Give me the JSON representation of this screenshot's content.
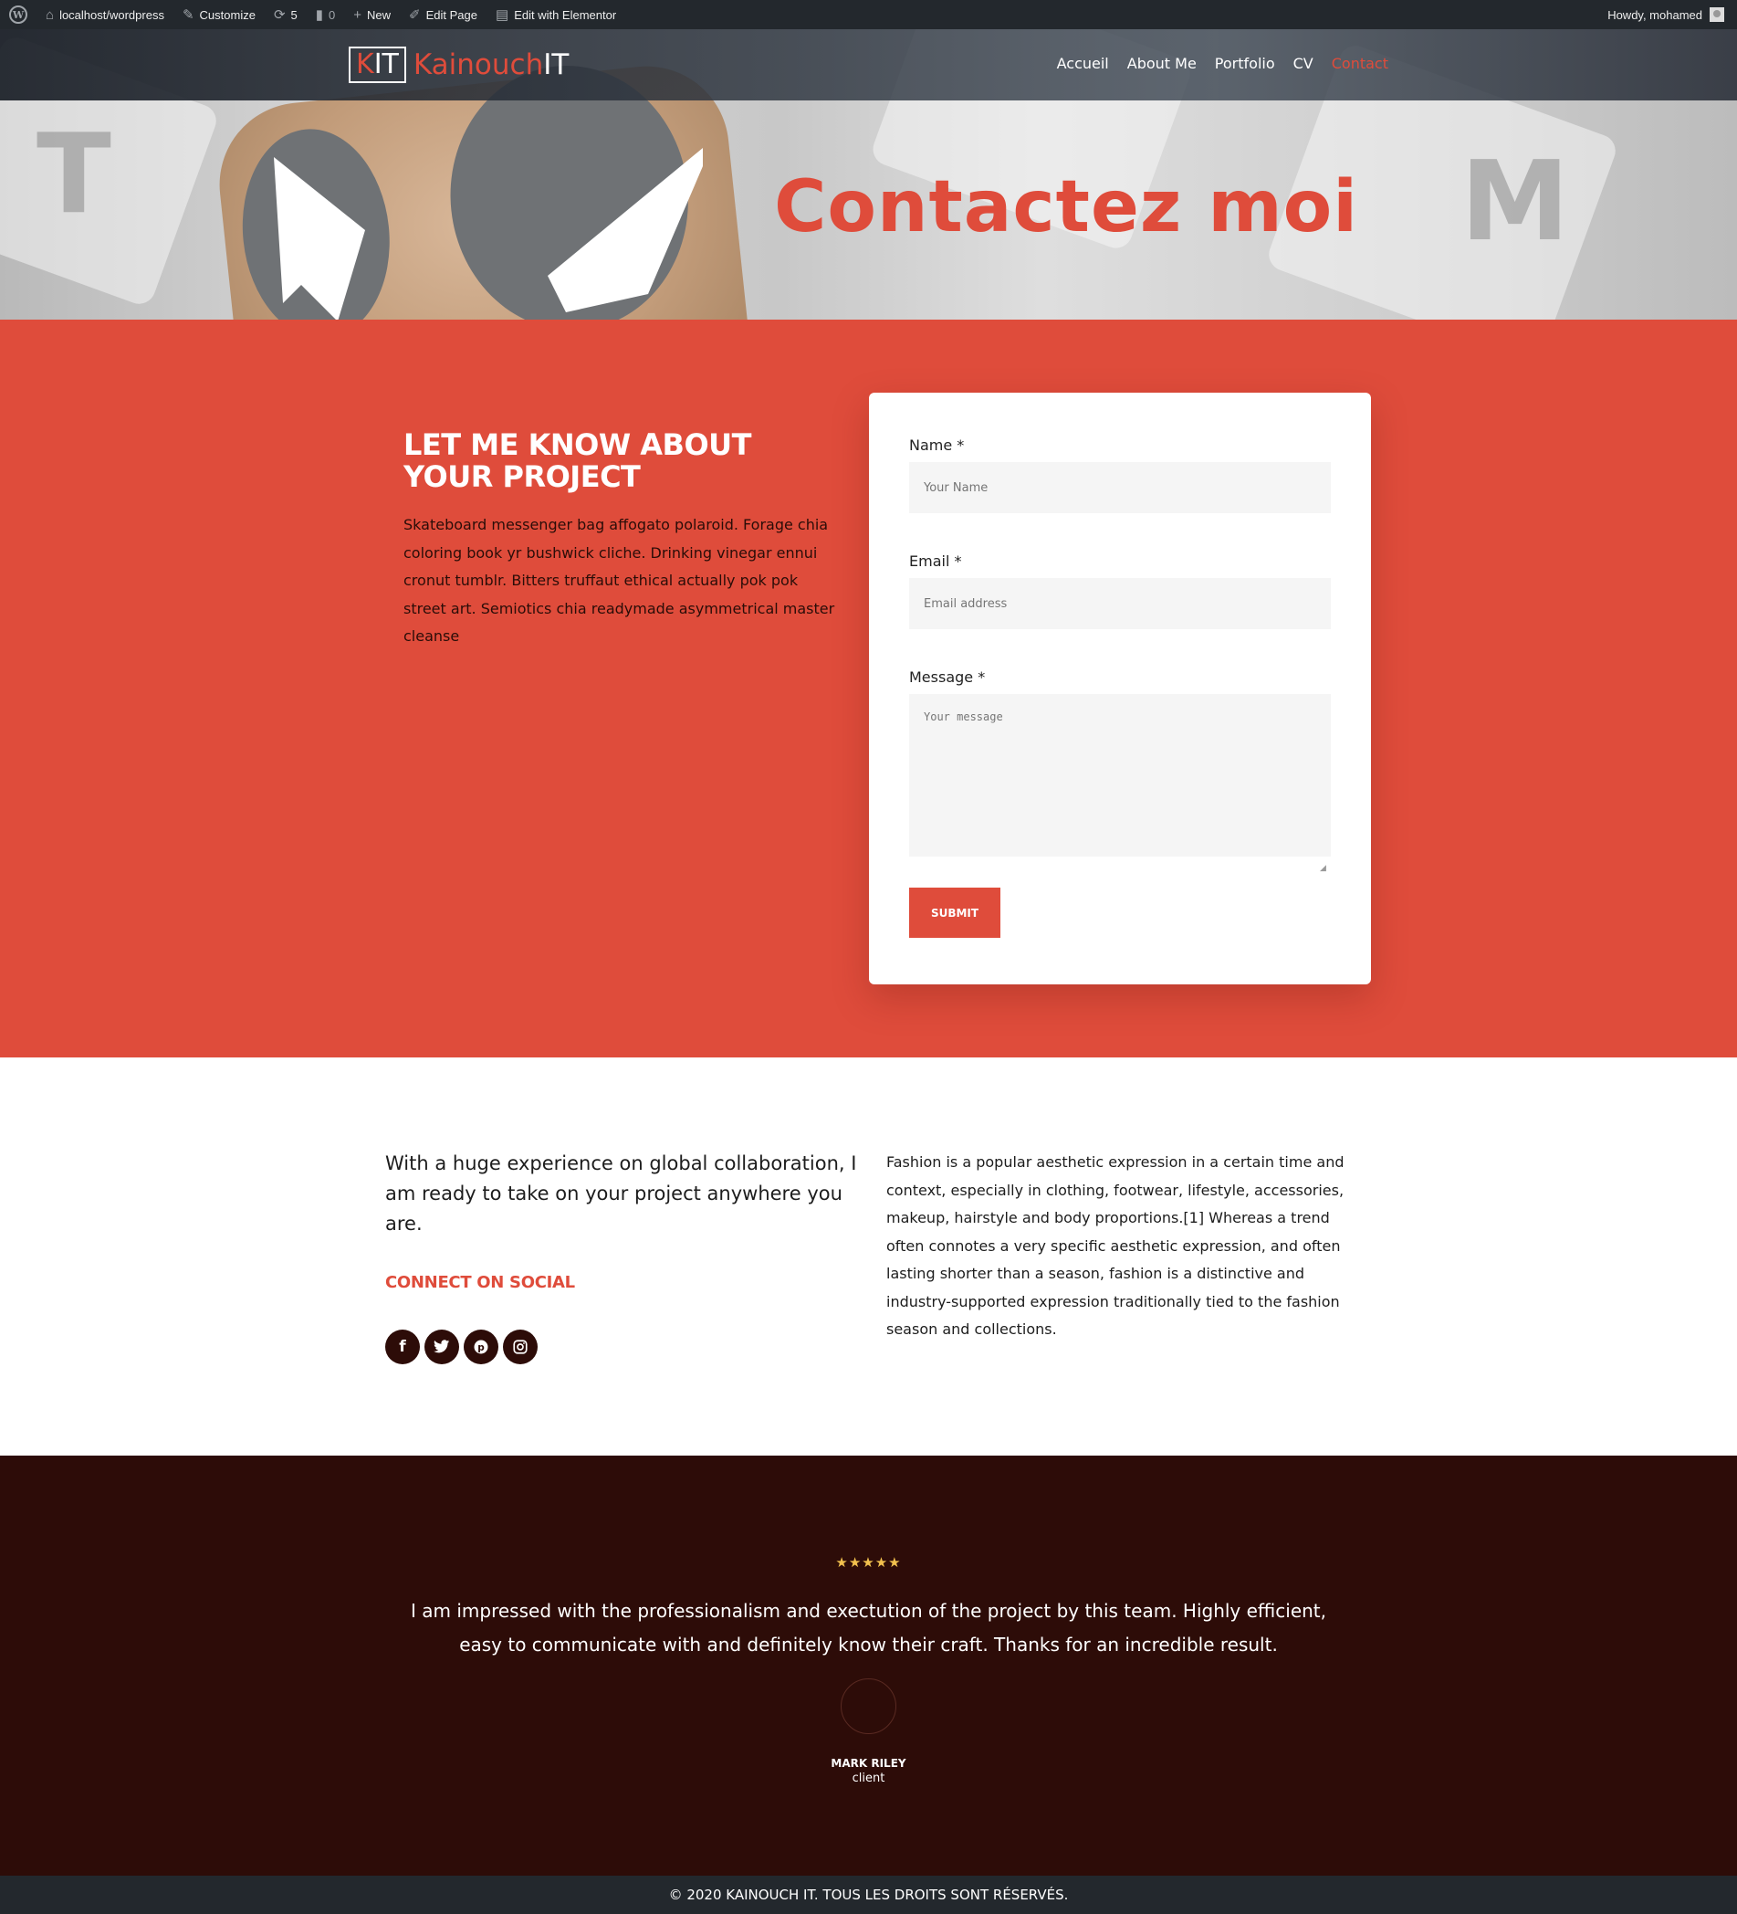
{
  "admin_bar": {
    "site": "localhost/wordpress",
    "customize": "Customize",
    "updates_count": "5",
    "comments_count": "0",
    "new": "New",
    "edit_page": "Edit Page",
    "edit_elementor": "Edit with Elementor",
    "howdy": "Howdy, mohamed"
  },
  "header": {
    "logo_box_k": "K",
    "logo_box_it": "IT",
    "logo_name": "Kainouch",
    "logo_name_it": "IT",
    "nav": [
      "Accueil",
      "About Me",
      "Portfolio",
      "CV",
      "Contact"
    ],
    "active_nav": "Contact"
  },
  "hero": {
    "title": "Contactez moi"
  },
  "contact": {
    "heading": "LET ME KNOW ABOUT YOUR PROJECT",
    "text": "Skateboard messenger bag affogato polaroid. Forage chia coloring book yr bushwick cliche. Drinking vinegar ennui cronut tumblr. Bitters truffaut ethical actually pok pok street art. Semiotics chia readymade asymmetrical master cleanse",
    "form": {
      "name_label": "Name *",
      "name_placeholder": "Your Name",
      "email_label": "Email *",
      "email_placeholder": "Email address",
      "message_label": "Message *",
      "message_placeholder": "Your message",
      "submit": "SUBMIT"
    }
  },
  "about": {
    "lead": "With a huge experience on global collaboration, I am ready to take on your project anywhere you are.",
    "social_heading": "CONNECT ON SOCIAL",
    "social_icons": [
      "facebook-icon",
      "twitter-icon",
      "pinterest-icon",
      "instagram-icon"
    ],
    "right_text": "Fashion is a popular aesthetic expression in a certain time and context, especially in clothing, footwear, lifestyle, accessories, makeup, hairstyle and body proportions.[1] Whereas a trend often connotes a very specific aesthetic expression, and often lasting shorter than a season, fashion is a distinctive and industry-supported expression traditionally tied to the fashion season and collections."
  },
  "testimonial": {
    "stars": "★★★★★",
    "rating": 5,
    "quote": "I am impressed with the professionalism and exectution of the project by this team. Highly efficient, easy to communicate with and definitely know their craft. Thanks for an incredible result.",
    "name": "MARK RILEY",
    "role": "client"
  },
  "footer": {
    "text": "© 2020 KAINOUCH IT. TOUS LES DROITS SONT RÉSERVÉS."
  },
  "colors": {
    "accent": "#df4c3b",
    "dark": "#2d0c08",
    "admin_bar": "#23282d",
    "star": "#f2c14e"
  }
}
